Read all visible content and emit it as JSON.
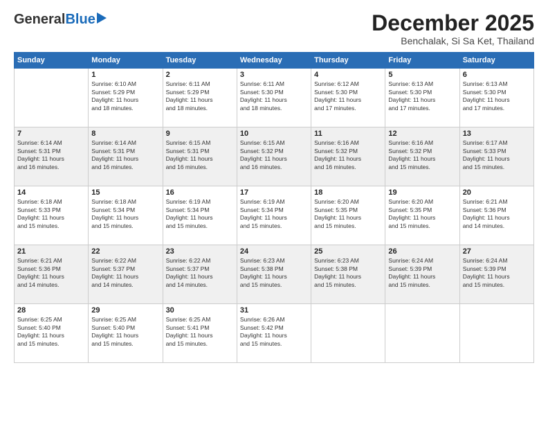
{
  "header": {
    "logo_general": "General",
    "logo_blue": "Blue",
    "month_title": "December 2025",
    "location": "Benchalak, Si Sa Ket, Thailand"
  },
  "weekdays": [
    "Sunday",
    "Monday",
    "Tuesday",
    "Wednesday",
    "Thursday",
    "Friday",
    "Saturday"
  ],
  "weeks": [
    [
      {
        "day": "",
        "info": ""
      },
      {
        "day": "1",
        "info": "Sunrise: 6:10 AM\nSunset: 5:29 PM\nDaylight: 11 hours\nand 18 minutes."
      },
      {
        "day": "2",
        "info": "Sunrise: 6:11 AM\nSunset: 5:29 PM\nDaylight: 11 hours\nand 18 minutes."
      },
      {
        "day": "3",
        "info": "Sunrise: 6:11 AM\nSunset: 5:30 PM\nDaylight: 11 hours\nand 18 minutes."
      },
      {
        "day": "4",
        "info": "Sunrise: 6:12 AM\nSunset: 5:30 PM\nDaylight: 11 hours\nand 17 minutes."
      },
      {
        "day": "5",
        "info": "Sunrise: 6:13 AM\nSunset: 5:30 PM\nDaylight: 11 hours\nand 17 minutes."
      },
      {
        "day": "6",
        "info": "Sunrise: 6:13 AM\nSunset: 5:30 PM\nDaylight: 11 hours\nand 17 minutes."
      }
    ],
    [
      {
        "day": "7",
        "info": "Sunrise: 6:14 AM\nSunset: 5:31 PM\nDaylight: 11 hours\nand 16 minutes."
      },
      {
        "day": "8",
        "info": "Sunrise: 6:14 AM\nSunset: 5:31 PM\nDaylight: 11 hours\nand 16 minutes."
      },
      {
        "day": "9",
        "info": "Sunrise: 6:15 AM\nSunset: 5:31 PM\nDaylight: 11 hours\nand 16 minutes."
      },
      {
        "day": "10",
        "info": "Sunrise: 6:15 AM\nSunset: 5:32 PM\nDaylight: 11 hours\nand 16 minutes."
      },
      {
        "day": "11",
        "info": "Sunrise: 6:16 AM\nSunset: 5:32 PM\nDaylight: 11 hours\nand 16 minutes."
      },
      {
        "day": "12",
        "info": "Sunrise: 6:16 AM\nSunset: 5:32 PM\nDaylight: 11 hours\nand 15 minutes."
      },
      {
        "day": "13",
        "info": "Sunrise: 6:17 AM\nSunset: 5:33 PM\nDaylight: 11 hours\nand 15 minutes."
      }
    ],
    [
      {
        "day": "14",
        "info": "Sunrise: 6:18 AM\nSunset: 5:33 PM\nDaylight: 11 hours\nand 15 minutes."
      },
      {
        "day": "15",
        "info": "Sunrise: 6:18 AM\nSunset: 5:34 PM\nDaylight: 11 hours\nand 15 minutes."
      },
      {
        "day": "16",
        "info": "Sunrise: 6:19 AM\nSunset: 5:34 PM\nDaylight: 11 hours\nand 15 minutes."
      },
      {
        "day": "17",
        "info": "Sunrise: 6:19 AM\nSunset: 5:34 PM\nDaylight: 11 hours\nand 15 minutes."
      },
      {
        "day": "18",
        "info": "Sunrise: 6:20 AM\nSunset: 5:35 PM\nDaylight: 11 hours\nand 15 minutes."
      },
      {
        "day": "19",
        "info": "Sunrise: 6:20 AM\nSunset: 5:35 PM\nDaylight: 11 hours\nand 15 minutes."
      },
      {
        "day": "20",
        "info": "Sunrise: 6:21 AM\nSunset: 5:36 PM\nDaylight: 11 hours\nand 14 minutes."
      }
    ],
    [
      {
        "day": "21",
        "info": "Sunrise: 6:21 AM\nSunset: 5:36 PM\nDaylight: 11 hours\nand 14 minutes."
      },
      {
        "day": "22",
        "info": "Sunrise: 6:22 AM\nSunset: 5:37 PM\nDaylight: 11 hours\nand 14 minutes."
      },
      {
        "day": "23",
        "info": "Sunrise: 6:22 AM\nSunset: 5:37 PM\nDaylight: 11 hours\nand 14 minutes."
      },
      {
        "day": "24",
        "info": "Sunrise: 6:23 AM\nSunset: 5:38 PM\nDaylight: 11 hours\nand 15 minutes."
      },
      {
        "day": "25",
        "info": "Sunrise: 6:23 AM\nSunset: 5:38 PM\nDaylight: 11 hours\nand 15 minutes."
      },
      {
        "day": "26",
        "info": "Sunrise: 6:24 AM\nSunset: 5:39 PM\nDaylight: 11 hours\nand 15 minutes."
      },
      {
        "day": "27",
        "info": "Sunrise: 6:24 AM\nSunset: 5:39 PM\nDaylight: 11 hours\nand 15 minutes."
      }
    ],
    [
      {
        "day": "28",
        "info": "Sunrise: 6:25 AM\nSunset: 5:40 PM\nDaylight: 11 hours\nand 15 minutes."
      },
      {
        "day": "29",
        "info": "Sunrise: 6:25 AM\nSunset: 5:40 PM\nDaylight: 11 hours\nand 15 minutes."
      },
      {
        "day": "30",
        "info": "Sunrise: 6:25 AM\nSunset: 5:41 PM\nDaylight: 11 hours\nand 15 minutes."
      },
      {
        "day": "31",
        "info": "Sunrise: 6:26 AM\nSunset: 5:42 PM\nDaylight: 11 hours\nand 15 minutes."
      },
      {
        "day": "",
        "info": ""
      },
      {
        "day": "",
        "info": ""
      },
      {
        "day": "",
        "info": ""
      }
    ]
  ]
}
